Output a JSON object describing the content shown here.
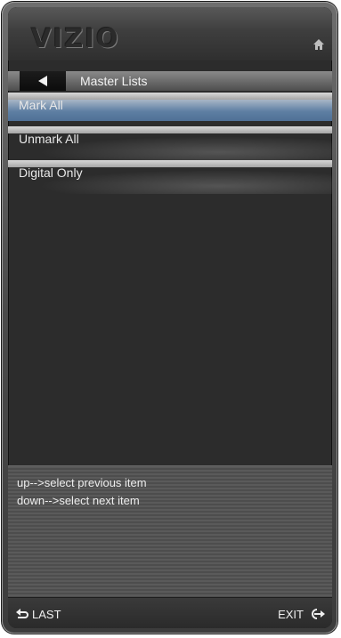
{
  "header": {
    "logo_text": "VIZIO",
    "home_icon": "home-icon"
  },
  "nav": {
    "back_icon": "left-triangle-icon",
    "title": "Master Lists"
  },
  "menu": {
    "items": [
      {
        "label": "Mark All",
        "selected": true
      },
      {
        "label": "Unmark All",
        "selected": false
      },
      {
        "label": "Digital Only",
        "selected": false
      }
    ]
  },
  "help": {
    "lines": [
      "up-->select previous item",
      "down-->select next item"
    ]
  },
  "footer": {
    "last_label": "LAST",
    "last_icon": "return-arrow-icon",
    "exit_label": "EXIT",
    "exit_icon": "exit-arrow-icon"
  },
  "colors": {
    "selected_highlight": "#5e7fa3",
    "panel_background": "#2c2c2c",
    "text": "#e8e8e8"
  }
}
